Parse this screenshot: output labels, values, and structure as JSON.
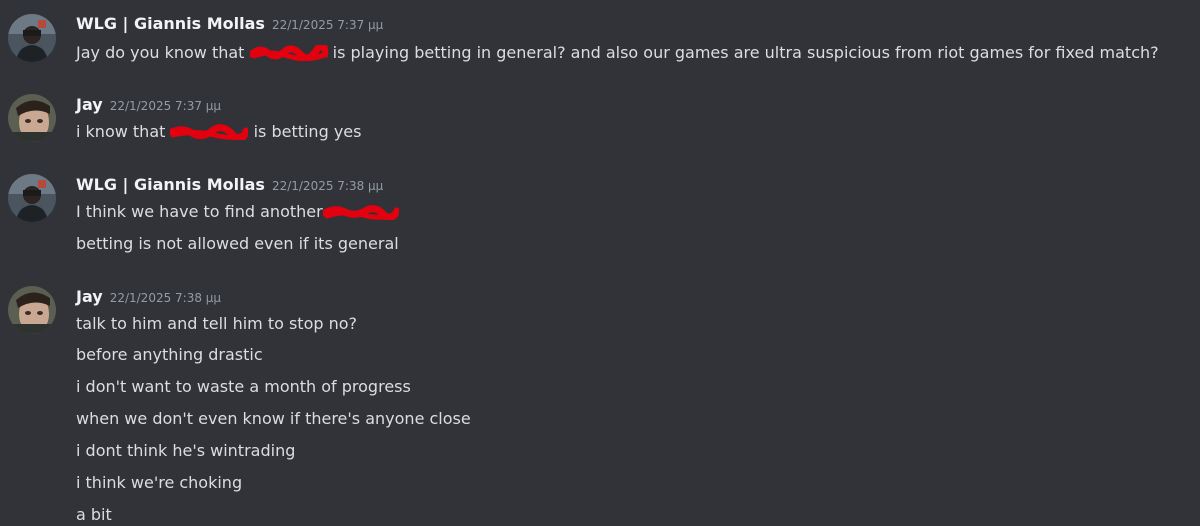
{
  "messages": [
    {
      "author": "WLG | Giannis Mollas",
      "timestamp": "22/1/2025 7:37 μμ",
      "avatar_icon": "user-avatar-icon",
      "lines": [
        {
          "parts": [
            "Jay do you know that ",
            "[redacted]",
            " is playing betting in general? and also our games are ultra suspicious from riot games for fixed match?"
          ]
        }
      ]
    },
    {
      "author": "Jay",
      "timestamp": "22/1/2025 7:37 μμ",
      "avatar_icon": "user-avatar-icon",
      "lines": [
        {
          "parts": [
            "i know that ",
            "[redacted]",
            " is betting yes"
          ]
        }
      ]
    },
    {
      "author": "WLG | Giannis Mollas",
      "timestamp": "22/1/2025 7:38 μμ",
      "avatar_icon": "user-avatar-icon",
      "lines": [
        {
          "parts": [
            "I think we have to find another",
            "[redacted]"
          ]
        },
        {
          "parts": [
            "betting is not allowed even if its general"
          ]
        }
      ]
    },
    {
      "author": "Jay",
      "timestamp": "22/1/2025 7:38 μμ",
      "avatar_icon": "user-avatar-icon",
      "lines": [
        {
          "parts": [
            "talk to him and tell him to stop no?"
          ]
        },
        {
          "parts": [
            "before anything drastic"
          ]
        },
        {
          "parts": [
            "i don't want to waste a month of progress"
          ]
        },
        {
          "parts": [
            "when we don't even know if there's anyone close"
          ]
        },
        {
          "parts": [
            "i dont think he's wintrading"
          ]
        },
        {
          "parts": [
            "i think we're choking"
          ]
        },
        {
          "parts": [
            "a bit"
          ]
        }
      ]
    }
  ],
  "colors": {
    "background": "#313338",
    "author": "#f2f3f5",
    "timestamp": "#949ba4",
    "text": "#dbdee1",
    "redaction": "#e3000f"
  }
}
